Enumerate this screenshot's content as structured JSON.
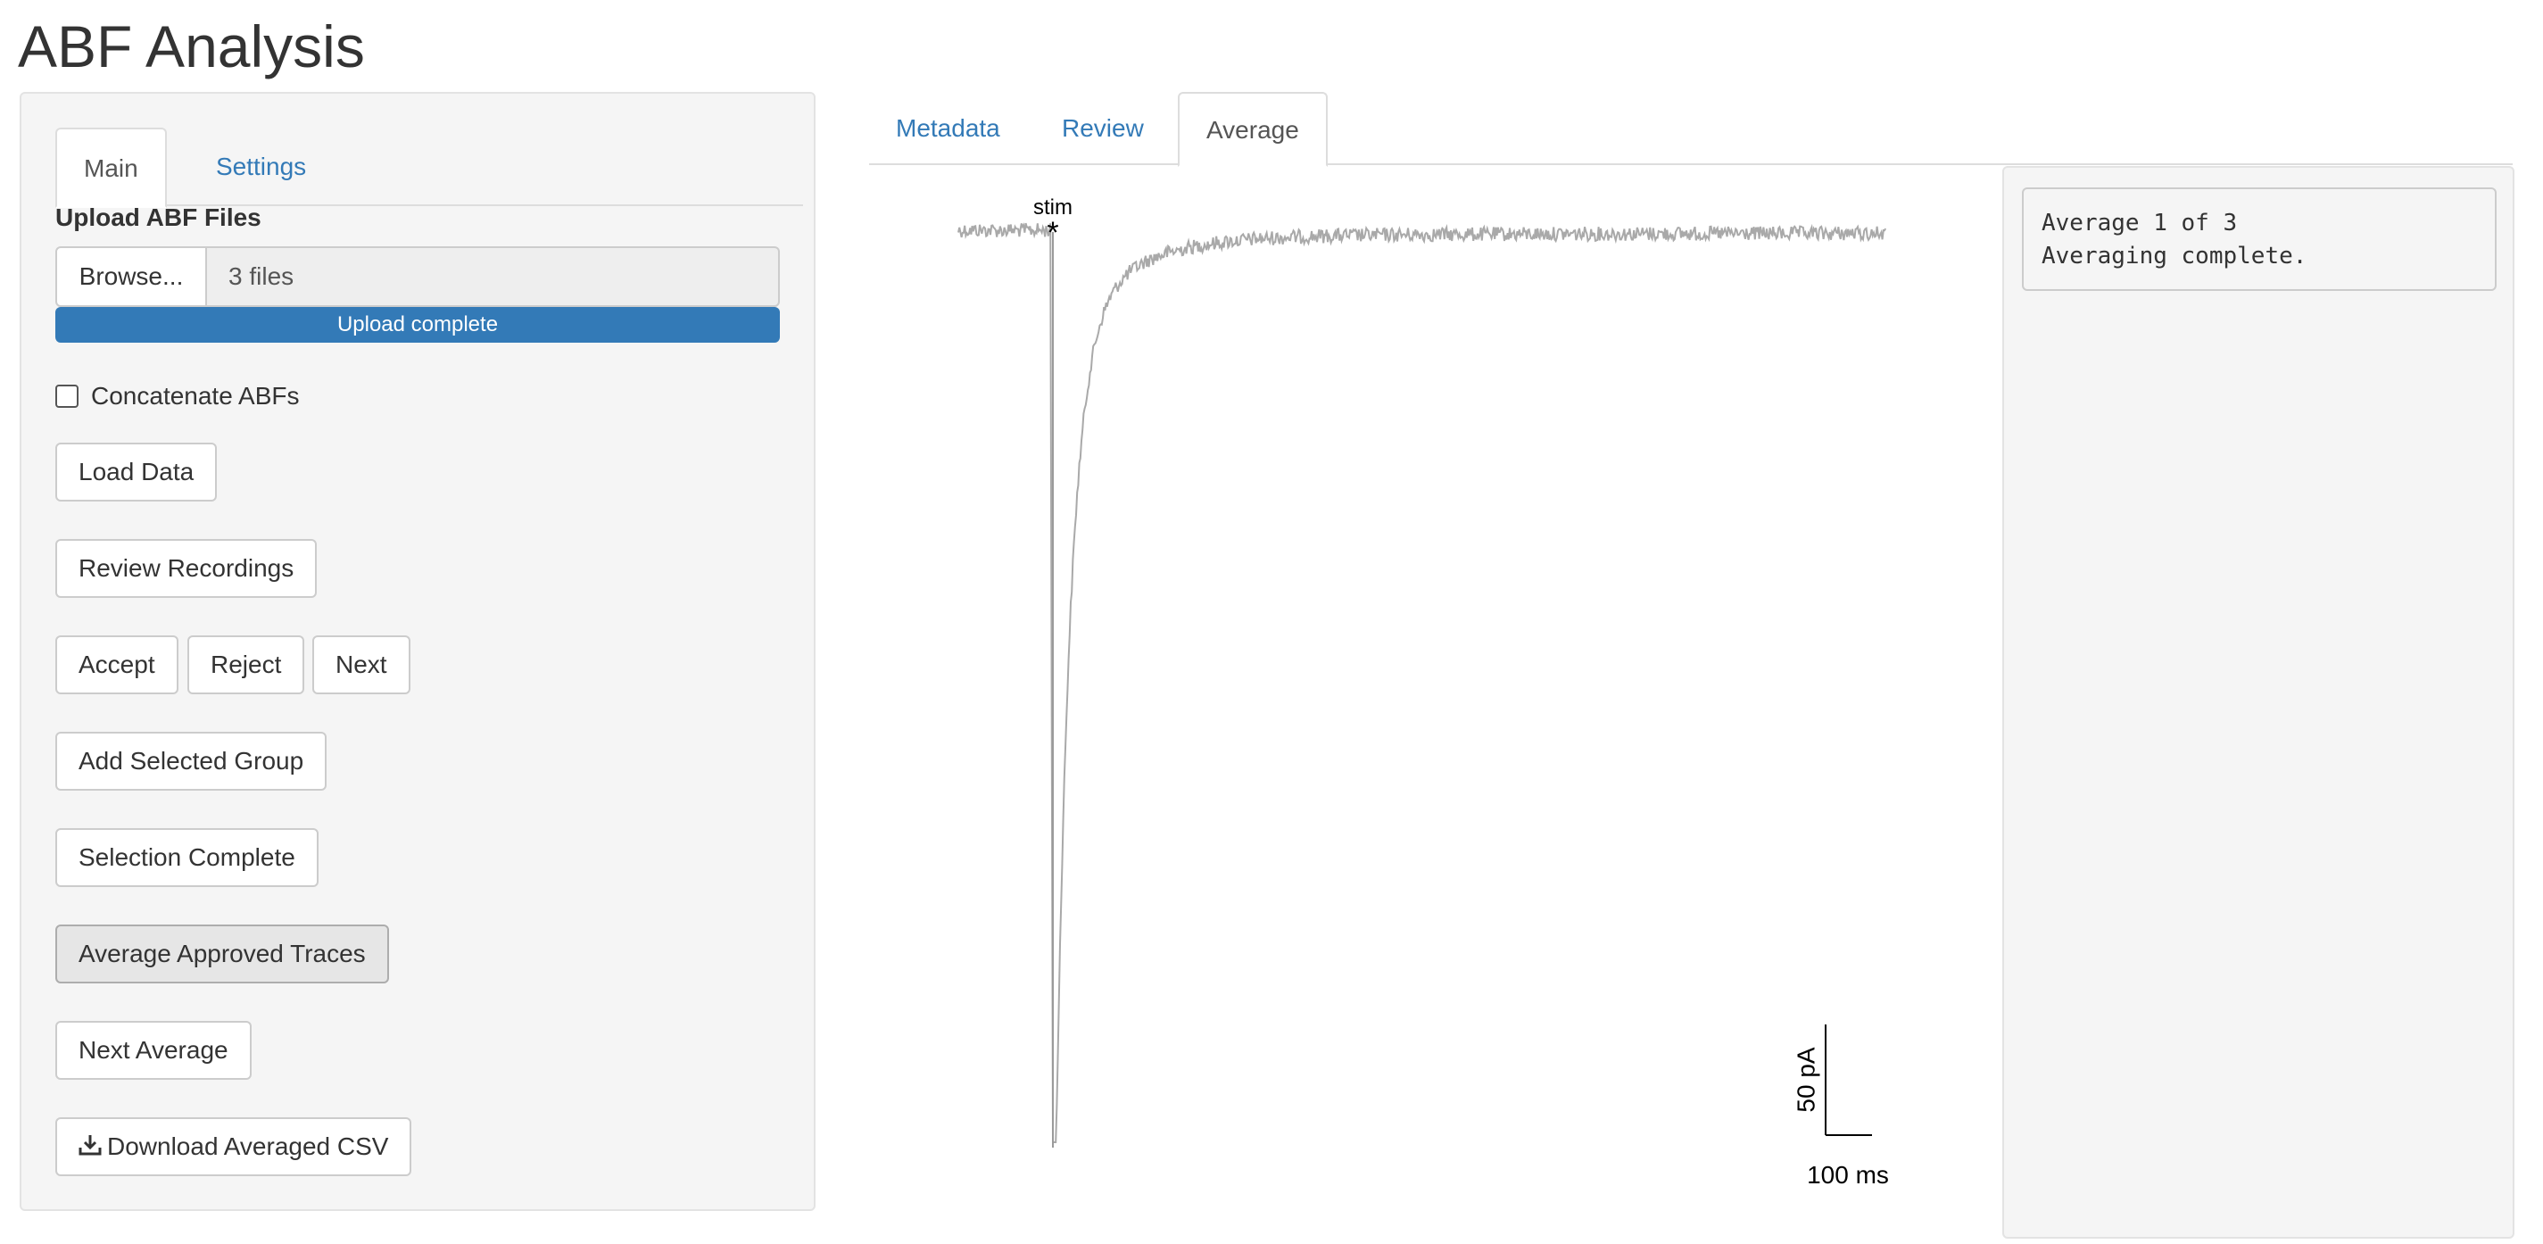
{
  "app": {
    "title": "ABF Analysis"
  },
  "sidebar": {
    "tabs": [
      {
        "label": "Main",
        "active": true
      },
      {
        "label": "Settings",
        "active": false
      }
    ],
    "upload": {
      "label": "Upload ABF Files",
      "browse_label": "Browse...",
      "file_display": "3 files",
      "progress_text": "Upload complete",
      "progress": 1.0
    },
    "concatenate": {
      "label": "Concatenate ABFs",
      "checked": false
    },
    "buttons": {
      "load_data": "Load Data",
      "review_recordings": "Review Recordings",
      "accept": "Accept",
      "reject": "Reject",
      "next": "Next",
      "add_selected_group": "Add Selected Group",
      "selection_complete": "Selection Complete",
      "average_approved": "Average Approved Traces",
      "next_average": "Next Average",
      "download_csv": "Download Averaged CSV"
    }
  },
  "main": {
    "tabs": [
      {
        "label": "Metadata",
        "active": false
      },
      {
        "label": "Review",
        "active": false
      },
      {
        "label": "Average",
        "active": true
      }
    ],
    "plot": {
      "stim_label": "stim",
      "stim_marker": "*",
      "scalebar_y_label": "50 pA",
      "scalebar_x_label": "100 ms",
      "trace_color": "#a9a9a9"
    },
    "log": [
      "Average 1 of 3",
      "Averaging complete."
    ]
  },
  "colors": {
    "accent": "#337ab7",
    "panel_bg": "#f5f5f5"
  }
}
